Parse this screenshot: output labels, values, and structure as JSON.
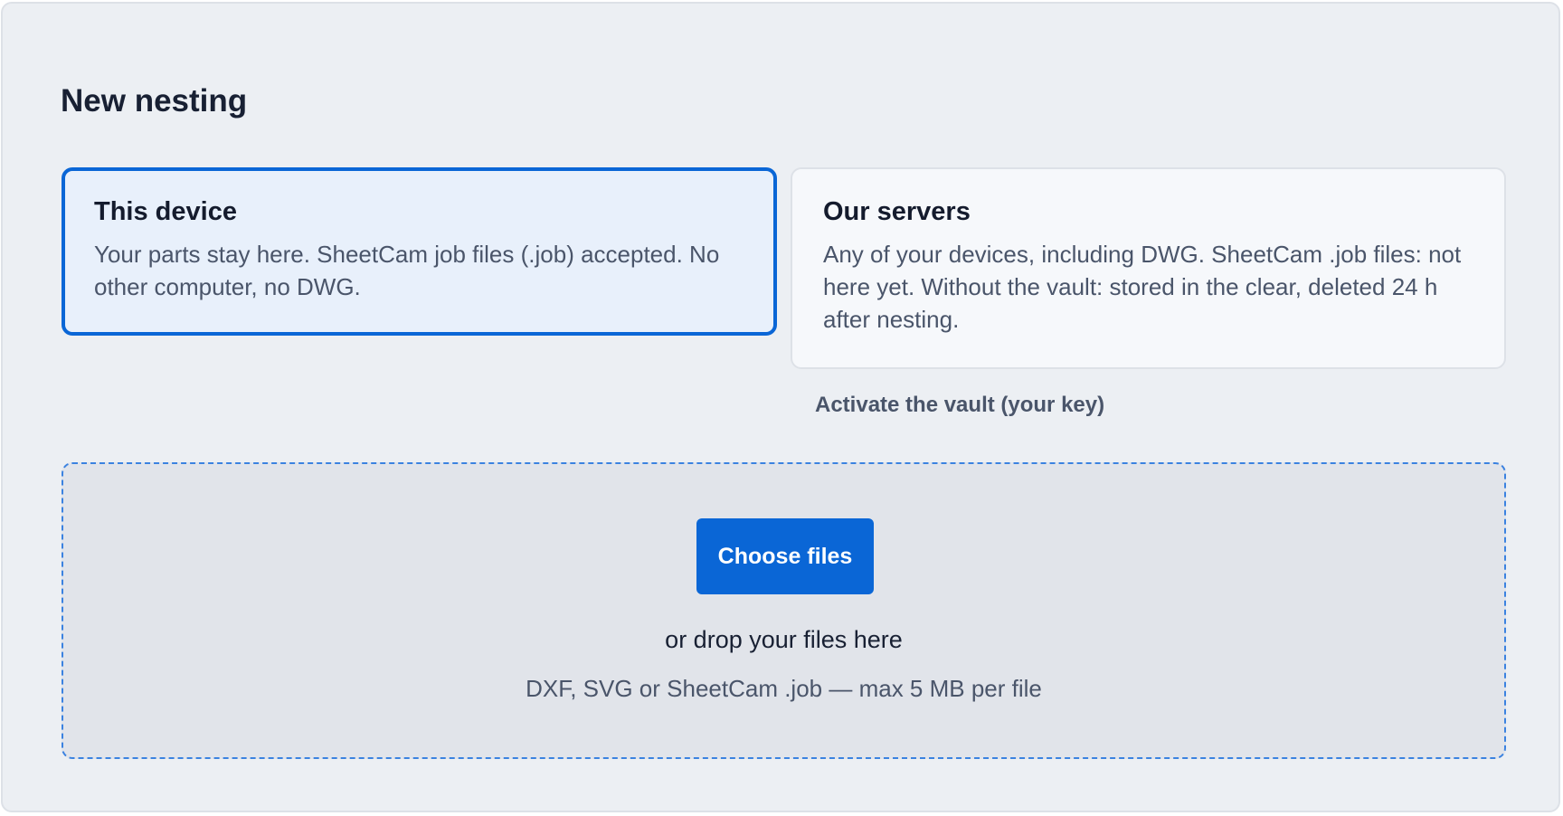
{
  "page": {
    "title": "New nesting"
  },
  "options": {
    "device": {
      "title": "This device",
      "description": "Your parts stay here. SheetCam job files (.job) accepted. No other computer, no DWG."
    },
    "servers": {
      "title": "Our servers",
      "description": "Any of your devices, including DWG. SheetCam .job files: not here yet. Without the vault: stored in the clear, deleted 24 h after nesting."
    },
    "selected": "This device"
  },
  "vault": {
    "link_label": "Activate the vault (your key)"
  },
  "upload": {
    "button_label": "Choose files",
    "drop_text": "or drop your files here",
    "hint": "DXF, SVG or SheetCam .job — max 5 MB per file"
  },
  "colors": {
    "accent": "#0a66d6",
    "background": "#eceff3",
    "dropzone_background": "#e1e4ea",
    "text_primary": "#182033",
    "text_secondary": "#4a556a"
  }
}
